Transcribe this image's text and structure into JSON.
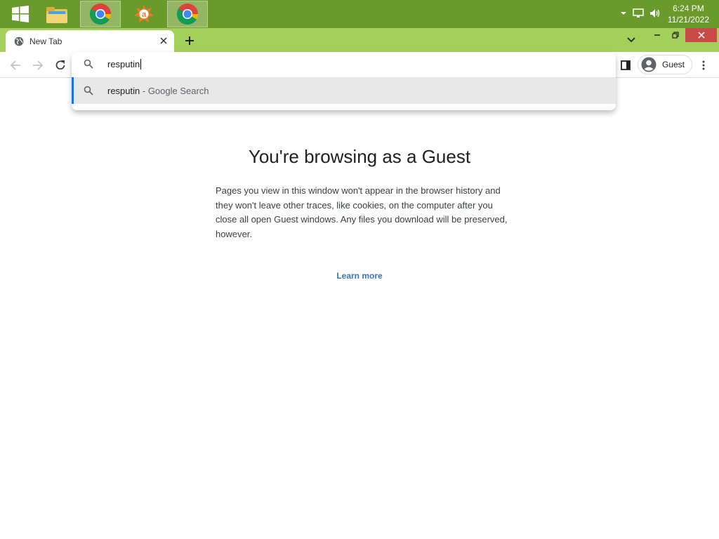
{
  "taskbar": {
    "apps": [
      {
        "name": "windows-start",
        "active": false
      },
      {
        "name": "file-explorer",
        "active": false
      },
      {
        "name": "chrome",
        "active": true
      },
      {
        "name": "avast",
        "active": false
      },
      {
        "name": "chrome",
        "active": true
      }
    ],
    "time": "6:24 PM",
    "date": "11/21/2022"
  },
  "browser": {
    "tab_title": "New Tab",
    "profile_label": "Guest",
    "accent_color": "#a3d05a"
  },
  "omnibox": {
    "query": "resputin",
    "suggestion_query": "resputin",
    "suggestion_engine": "- Google Search"
  },
  "page": {
    "title": "You're browsing as a Guest",
    "description": "Pages you view in this window won't appear in the browser history and they won't leave other traces, like cookies, on the computer after you close all open Guest windows. Any files you download will be preserved, however.",
    "learn_more": "Learn more"
  }
}
